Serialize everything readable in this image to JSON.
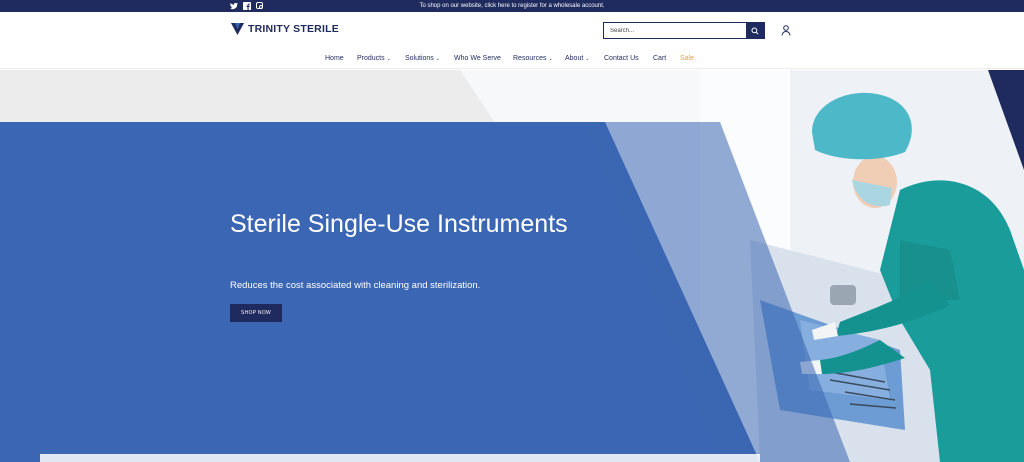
{
  "announcement": {
    "message": "To shop on our website, click here to register for a wholesale account."
  },
  "socials": [
    "twitter-icon",
    "facebook-icon",
    "instagram-icon"
  ],
  "brand": {
    "name": "TRINITY STERILE",
    "color": "#1f2a5e"
  },
  "search": {
    "placeholder": "Search..."
  },
  "nav": {
    "items": [
      {
        "label": "Home",
        "dropdown": false
      },
      {
        "label": "Products",
        "dropdown": true
      },
      {
        "label": "Solutions",
        "dropdown": true
      },
      {
        "label": "Who We Serve",
        "dropdown": false
      },
      {
        "label": "Resources",
        "dropdown": true
      },
      {
        "label": "About",
        "dropdown": true
      },
      {
        "label": "Contact Us",
        "dropdown": false
      },
      {
        "label": "Cart",
        "dropdown": false
      },
      {
        "label": "Sale",
        "dropdown": false
      }
    ],
    "sale_color": "#e8a23b"
  },
  "hero": {
    "title": "Sterile Single-Use Instruments",
    "subtitle": "Reduces the cost associated with cleaning and sterilization.",
    "cta_label": "SHOP NOW",
    "accent_color": "#3b66b3"
  }
}
